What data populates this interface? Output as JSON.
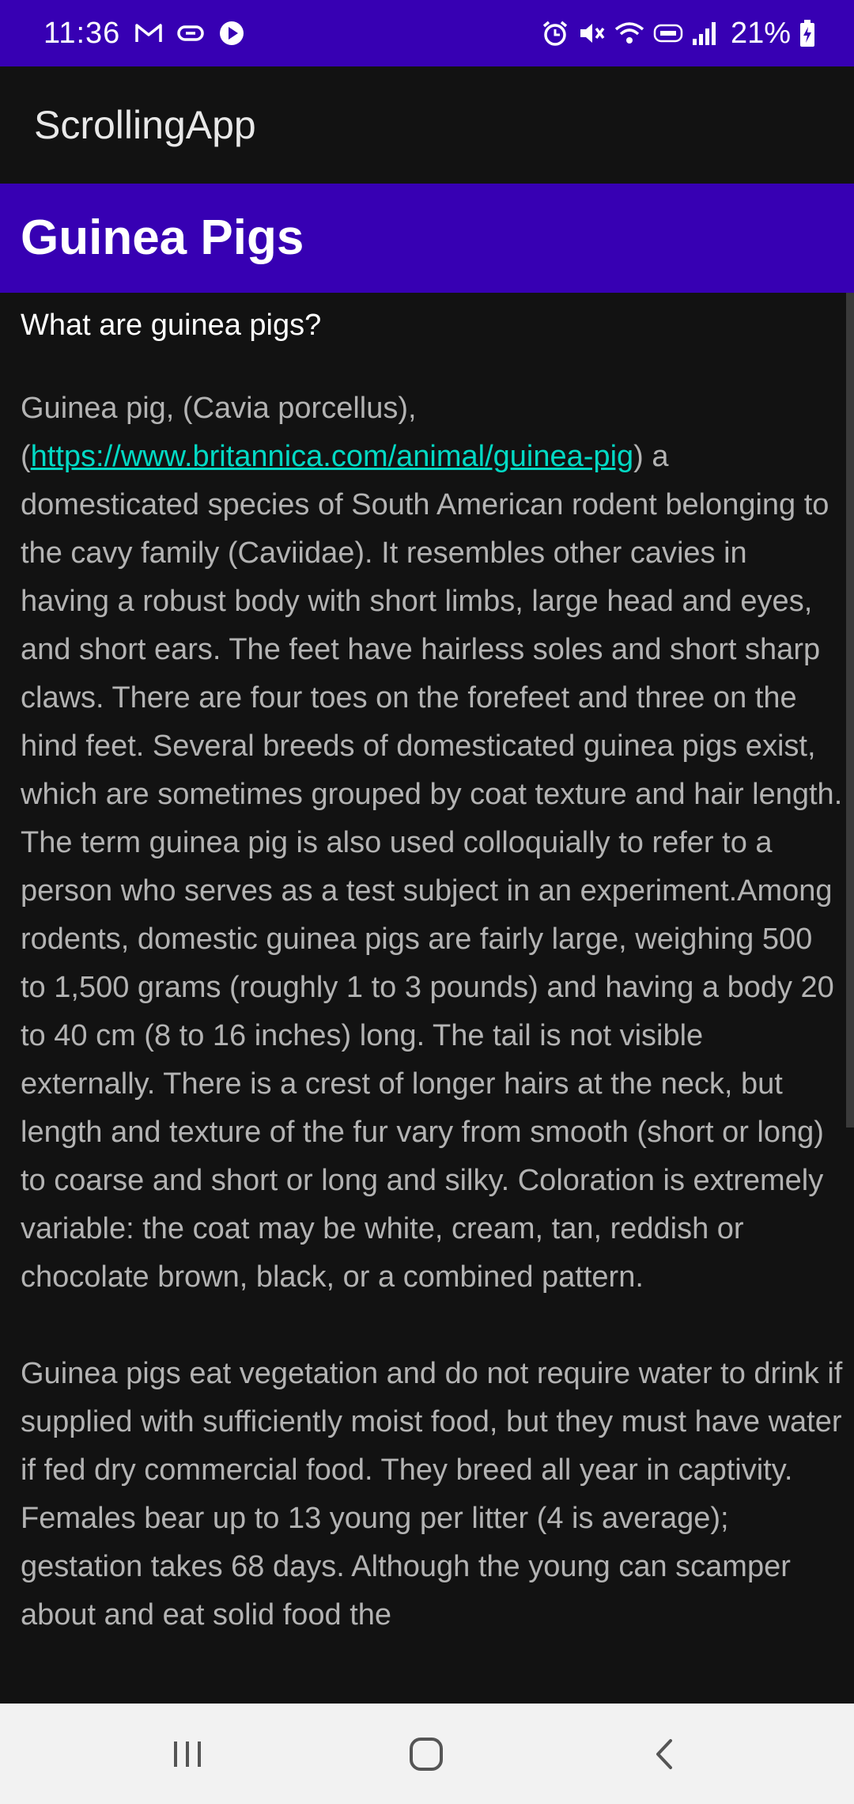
{
  "status_bar": {
    "time": "11:36",
    "battery": "21%",
    "left_icons": [
      "gmail-icon",
      "pill-icon",
      "play-icon"
    ],
    "right_icons": [
      "alarm-icon",
      "mute-icon",
      "wifi-icon",
      "volte-icon",
      "signal-icon",
      "battery-charging-icon"
    ]
  },
  "app_bar": {
    "title": "ScrollingApp"
  },
  "article": {
    "heading": "Guinea Pigs",
    "subheading": "What are guinea pigs?",
    "para1_start": "Guinea pig, (Cavia porcellus),(",
    "link": "https://www.britannica.com/animal/guinea-pig",
    "para1_rest": ") a domesticated species of South American rodent belonging to the cavy family (Caviidae). It resembles other cavies in having a robust body with short limbs, large head and eyes, and short ears. The feet have hairless soles and short sharp claws. There are four toes on the forefeet and three on the hind feet. Several breeds of domesticated guinea pigs exist, which are sometimes grouped by coat texture and hair length. The term guinea pig is also used colloquially to refer to a person who serves as a test subject in an experiment.Among rodents, domestic guinea pigs are fairly large, weighing 500 to 1,500 grams (roughly 1 to 3 pounds) and having a body 20 to 40 cm (8 to 16 inches) long. The tail is not visible externally. There is a crest of longer hairs at the neck, but length and texture of the fur vary from smooth (short or long) to coarse and short or long and silky. Coloration is extremely variable: the coat may be white, cream, tan, reddish or chocolate brown, black, or a combined pattern.",
    "para2": " Guinea pigs eat vegetation and do not require water to drink if supplied with sufficiently moist food, but they must have water if fed dry commercial food. They breed all year in captivity. Females bear up to 13 young per litter (4 is average); gestation takes 68 days. Although the young can scamper about and eat solid food the"
  },
  "nav_bar": {
    "buttons": [
      "recents-button",
      "home-button",
      "back-button"
    ]
  },
  "colors": {
    "primary": "#3700B3",
    "background": "#121212",
    "link": "#03DAC5",
    "body_text": "#b3b3b3"
  }
}
